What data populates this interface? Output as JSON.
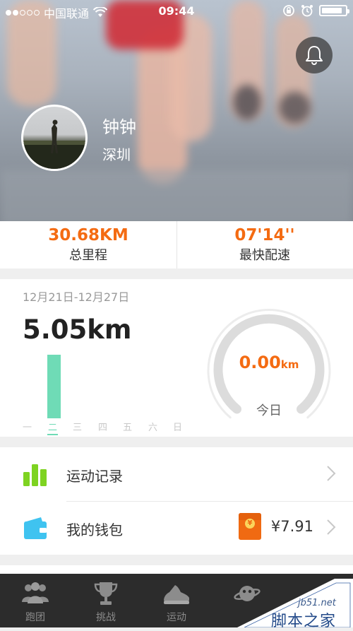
{
  "status_bar": {
    "carrier": "中国联通",
    "time": "09:44"
  },
  "profile": {
    "name": "钟钟",
    "city": "深圳"
  },
  "stats": [
    {
      "value": "30.68KM",
      "label": "总里程"
    },
    {
      "value": "07'14''",
      "label": "最快配速"
    }
  ],
  "week": {
    "range": "12月21日-12月27日",
    "distance": "5.05km",
    "days": [
      "一",
      "二",
      "三",
      "四",
      "五",
      "六",
      "日"
    ],
    "active_day_index": 1,
    "bar_fraction": 1.0,
    "today": {
      "value": "0.00",
      "unit": "km",
      "label": "今日"
    }
  },
  "menu": {
    "records": {
      "label": "运动记录"
    },
    "wallet": {
      "label": "我的钱包",
      "amount": "¥7.91"
    }
  },
  "tabbar": {
    "tabs": [
      {
        "label": "跑团",
        "icon": "team-icon"
      },
      {
        "label": "挑战",
        "icon": "trophy-icon"
      },
      {
        "label": "运动",
        "icon": "shoe-icon"
      },
      {
        "label": "",
        "icon": "planet-icon"
      }
    ]
  },
  "watermark": {
    "site": "jb51.net",
    "name": "脚本之家"
  },
  "colors": {
    "accent_orange": "#f46b12",
    "bar_green": "#6fdbb6",
    "records_icon_green": "#7ed321",
    "wallet_icon_blue": "#3fc3f0",
    "tabbar_bg": "#2c2c2c"
  }
}
